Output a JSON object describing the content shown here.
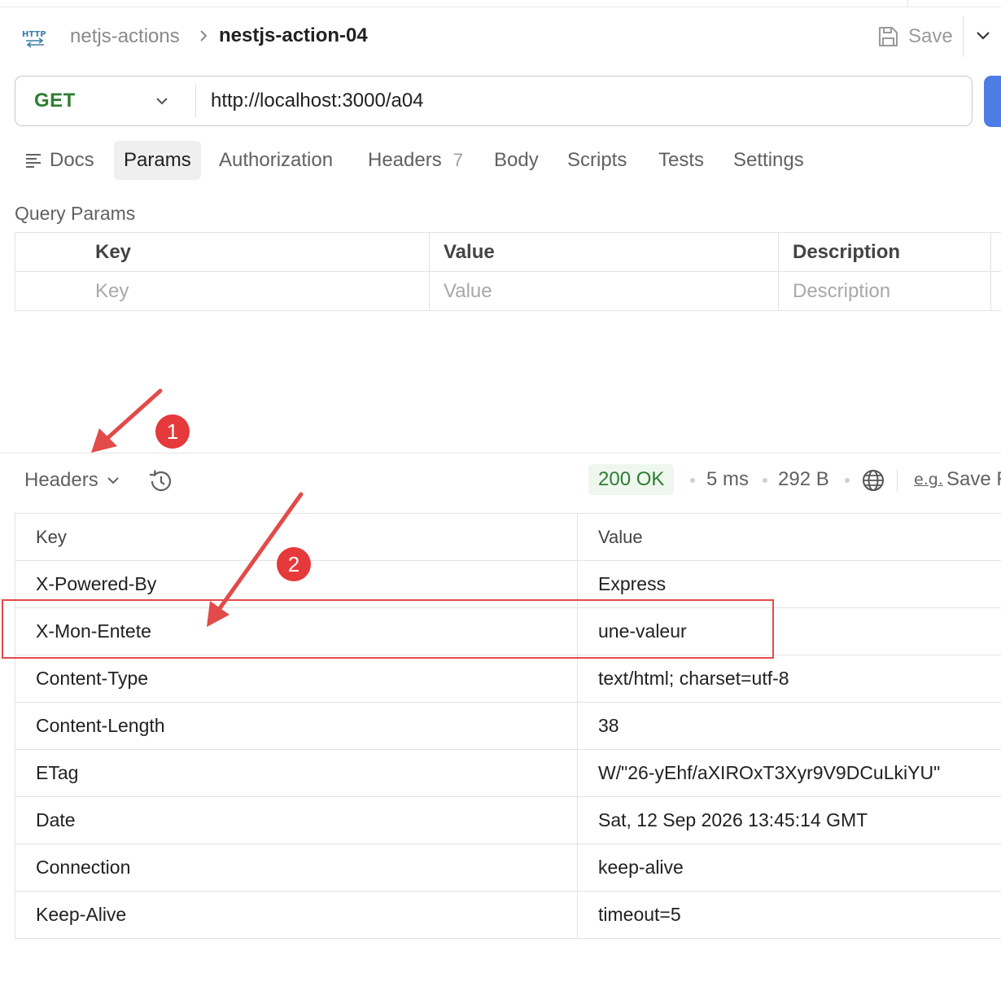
{
  "breadcrumb": {
    "parent": "netjs-actions",
    "current": "nestjs-action-04"
  },
  "header": {
    "save_label": "Save"
  },
  "request": {
    "method": "GET",
    "url": "http://localhost:3000/a04"
  },
  "tabs": [
    {
      "label": "Docs"
    },
    {
      "label": "Params",
      "active": true
    },
    {
      "label": "Authorization"
    },
    {
      "label": "Headers",
      "count": "7"
    },
    {
      "label": "Body"
    },
    {
      "label": "Scripts"
    },
    {
      "label": "Tests"
    },
    {
      "label": "Settings"
    }
  ],
  "query_params": {
    "title": "Query Params",
    "columns": [
      "Key",
      "Value",
      "Description"
    ],
    "placeholders": [
      "Key",
      "Value",
      "Description"
    ]
  },
  "response": {
    "view_label": "Headers",
    "status": "200 OK",
    "time": "5 ms",
    "size": "292 B",
    "save_label": "Save R",
    "columns": [
      "Key",
      "Value"
    ],
    "headers": [
      {
        "key": "X-Powered-By",
        "value": "Express"
      },
      {
        "key": "X-Mon-Entete",
        "value": "une-valeur"
      },
      {
        "key": "Content-Type",
        "value": "text/html; charset=utf-8"
      },
      {
        "key": "Content-Length",
        "value": "38"
      },
      {
        "key": "ETag",
        "value": "W/\"26-yEhf/aXIROxT3Xyr9V9DCuLkiYU\""
      },
      {
        "key": "Date",
        "value": "Sat, 12 Sep 2026 13:45:14 GMT"
      },
      {
        "key": "Connection",
        "value": "keep-alive"
      },
      {
        "key": "Keep-Alive",
        "value": "timeout=5"
      }
    ]
  },
  "annotations": {
    "badge_1": "1",
    "badge_2": "2"
  },
  "colors": {
    "accent": "#4e7ce5",
    "method": "#2e7d32",
    "status_ok": "#2e7d32",
    "annotation": "#e5393b"
  },
  "icons": [
    "http-icon",
    "chevron-right-icon",
    "save-icon",
    "chevron-down-icon",
    "docs-icon",
    "history-icon",
    "globe-icon",
    "example-icon"
  ]
}
